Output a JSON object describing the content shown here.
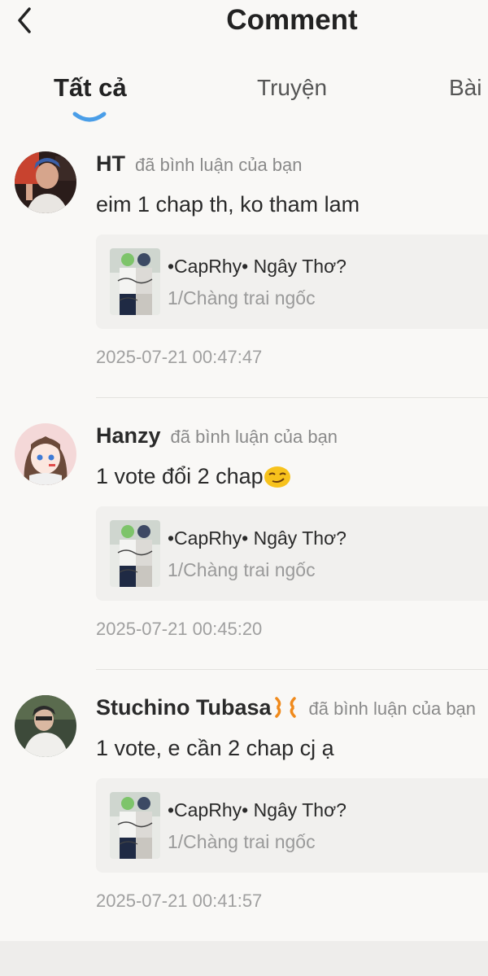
{
  "header": {
    "title": "Comment",
    "back_icon": "chevron-left-icon"
  },
  "tabs": [
    {
      "label": "Tất cả",
      "active": true
    },
    {
      "label": "Truyện",
      "active": false
    },
    {
      "label": "Bài",
      "active": false
    }
  ],
  "comments": [
    {
      "user": "HT",
      "action": "đã bình luận của bạn",
      "text": "eim 1 chap th, ko tham lam",
      "book_title": "•CapRhy• Ngây Thơ?",
      "chapter": "1/Chàng trai ngốc",
      "time": "2025-07-21 00:47:47"
    },
    {
      "user": "Hanzy",
      "action": "đã bình luận của bạn",
      "text": "1 vote đổi 2 chap",
      "text_emoji": "smirking-face-emoji",
      "book_title": "•CapRhy• Ngây Thơ?",
      "chapter": "1/Chàng trai ngốc",
      "time": "2025-07-21 00:45:20"
    },
    {
      "user": "Stuchino Tubasa",
      "user_emoji": "anger-symbol-emoji",
      "action": "đã bình luận của bạn",
      "text": "1 vote, e cần 2 chap cj ạ",
      "book_title": "•CapRhy• Ngây Thơ?",
      "chapter": "1/Chàng trai ngốc",
      "time": "2025-07-21 00:41:57"
    }
  ],
  "colors": {
    "accent": "#4a9ee8",
    "background": "#f9f8f6",
    "card": "#f1f0ee"
  }
}
